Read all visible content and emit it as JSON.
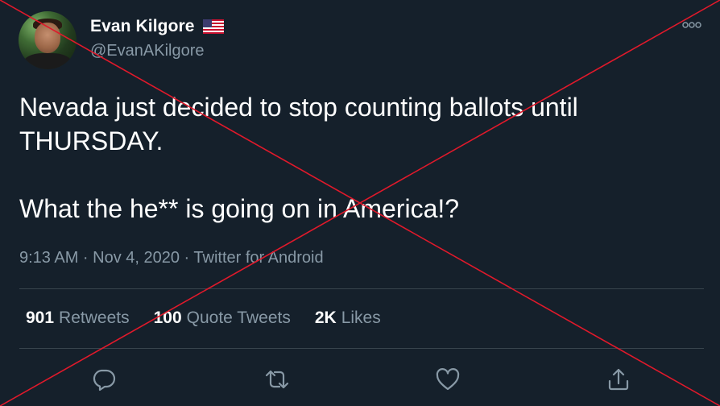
{
  "user": {
    "display_name": "Evan Kilgore",
    "handle": "@EvanAKilgore"
  },
  "tweet": {
    "text": "Nevada just decided to stop counting ballots until THURSDAY.\n\nWhat the he** is going on in America!?",
    "meta": "9:13 AM · Nov 4, 2020 · Twitter for Android"
  },
  "stats": {
    "retweets_count": "901",
    "retweets_label": "Retweets",
    "quote_count": "100",
    "quote_label": "Quote Tweets",
    "likes_count": "2K",
    "likes_label": "Likes"
  },
  "icons": [
    "more-icon",
    "flag-us-icon",
    "reply-icon",
    "retweet-icon",
    "like-icon",
    "share-icon"
  ],
  "colors": {
    "background": "#15202b",
    "text": "#ffffff",
    "secondary_text": "#8899a6",
    "divider": "#38444d",
    "overlay_cross": "#e0192b"
  }
}
